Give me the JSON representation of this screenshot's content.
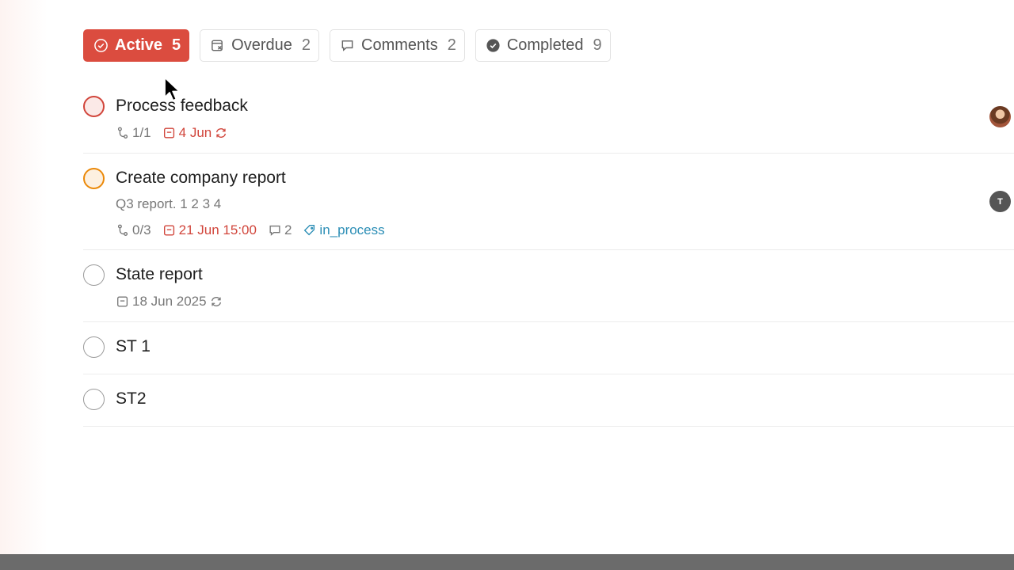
{
  "filters": [
    {
      "label": "Active",
      "count": "5",
      "icon": "check-circle-icon",
      "active": true
    },
    {
      "label": "Overdue",
      "count": "2",
      "icon": "overdue-calendar-icon",
      "active": false
    },
    {
      "label": "Comments",
      "count": "2",
      "icon": "comment-icon",
      "active": false
    },
    {
      "label": "Completed",
      "count": "9",
      "icon": "check-filled-icon",
      "active": false
    }
  ],
  "tasks": [
    {
      "title": "Process feedback",
      "priority": "p1",
      "subtasks": "1/1",
      "due": "4 Jun",
      "recurring": true,
      "assignee": "photo"
    },
    {
      "title": "Create company report",
      "priority": "p2",
      "description": "Q3 report. 1 2 3 4",
      "subtasks": "0/3",
      "due": "21 Jun 15:00",
      "comments": "2",
      "label": "in_process",
      "assignee": "T"
    },
    {
      "title": "State report",
      "priority": "p4",
      "due": "18 Jun 2025",
      "recurring": true
    },
    {
      "title": "ST 1",
      "priority": "p4"
    },
    {
      "title": "ST2",
      "priority": "p4"
    }
  ],
  "colors": {
    "accent": "#db4c3f",
    "priority1": "#d1453b",
    "priority2": "#eb8909",
    "label": "#2a8db5",
    "muted": "#777777"
  }
}
